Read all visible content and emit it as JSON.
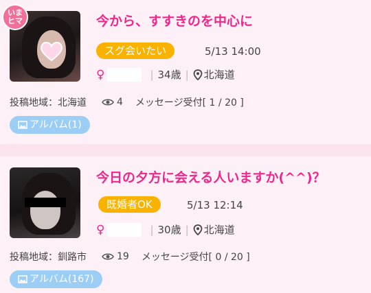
{
  "posts": [
    {
      "photo_badge": [
        "いま",
        "ヒマ"
      ],
      "title": "今から、すすきのを中心に",
      "tag": "スグ会いたい",
      "datetime": "5/13 14:00",
      "gender_symbol": "♀",
      "age": "34歳",
      "location": "北海道",
      "post_area": "投稿地域：北海道",
      "views": "4",
      "reply_status": "メッセージ受付[ 1 / 20 ]",
      "album_label": "アルバム(1)"
    },
    {
      "title": "今日の夕方に会える人いますか(^^)？",
      "tag": "既婚者OK",
      "datetime": "5/13 12:14",
      "gender_symbol": "♀",
      "age": "30歳",
      "location": "北海道",
      "post_area": "投稿地域：釧路市",
      "views": "19",
      "reply_status": "メッセージ受付[ 0 / 20 ]",
      "album_label": "アルバム(167)"
    }
  ],
  "colors": {
    "title": "#f0268a",
    "badge": "#f9b200",
    "album": "#9ccdf5",
    "card_bg": "#fdf0f6"
  }
}
